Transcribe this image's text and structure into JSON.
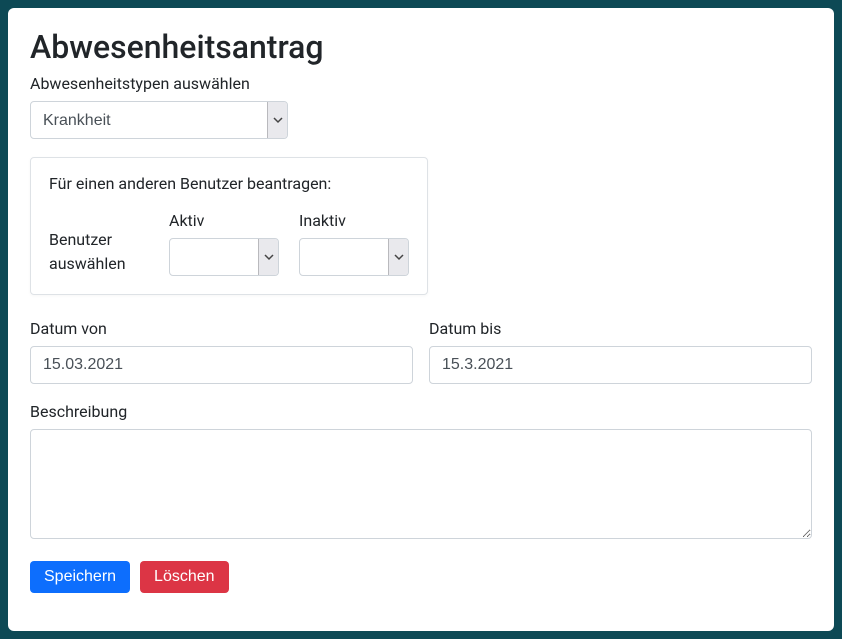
{
  "title": "Abwesenheitsantrag",
  "absence_type": {
    "label": "Abwesenheitstypen auswählen",
    "selected": "Krankheit"
  },
  "other_user": {
    "title": "Für einen anderen Benutzer beantragen:",
    "select_user_label": "Benutzer auswählen",
    "active": {
      "label": "Aktiv",
      "selected": ""
    },
    "inactive": {
      "label": "Inaktiv",
      "selected": ""
    }
  },
  "date_from": {
    "label": "Datum von",
    "value": "15.03.2021"
  },
  "date_to": {
    "label": "Datum bis",
    "value": "15.3.2021"
  },
  "description": {
    "label": "Beschreibung",
    "value": ""
  },
  "buttons": {
    "save": "Speichern",
    "delete": "Löschen"
  }
}
